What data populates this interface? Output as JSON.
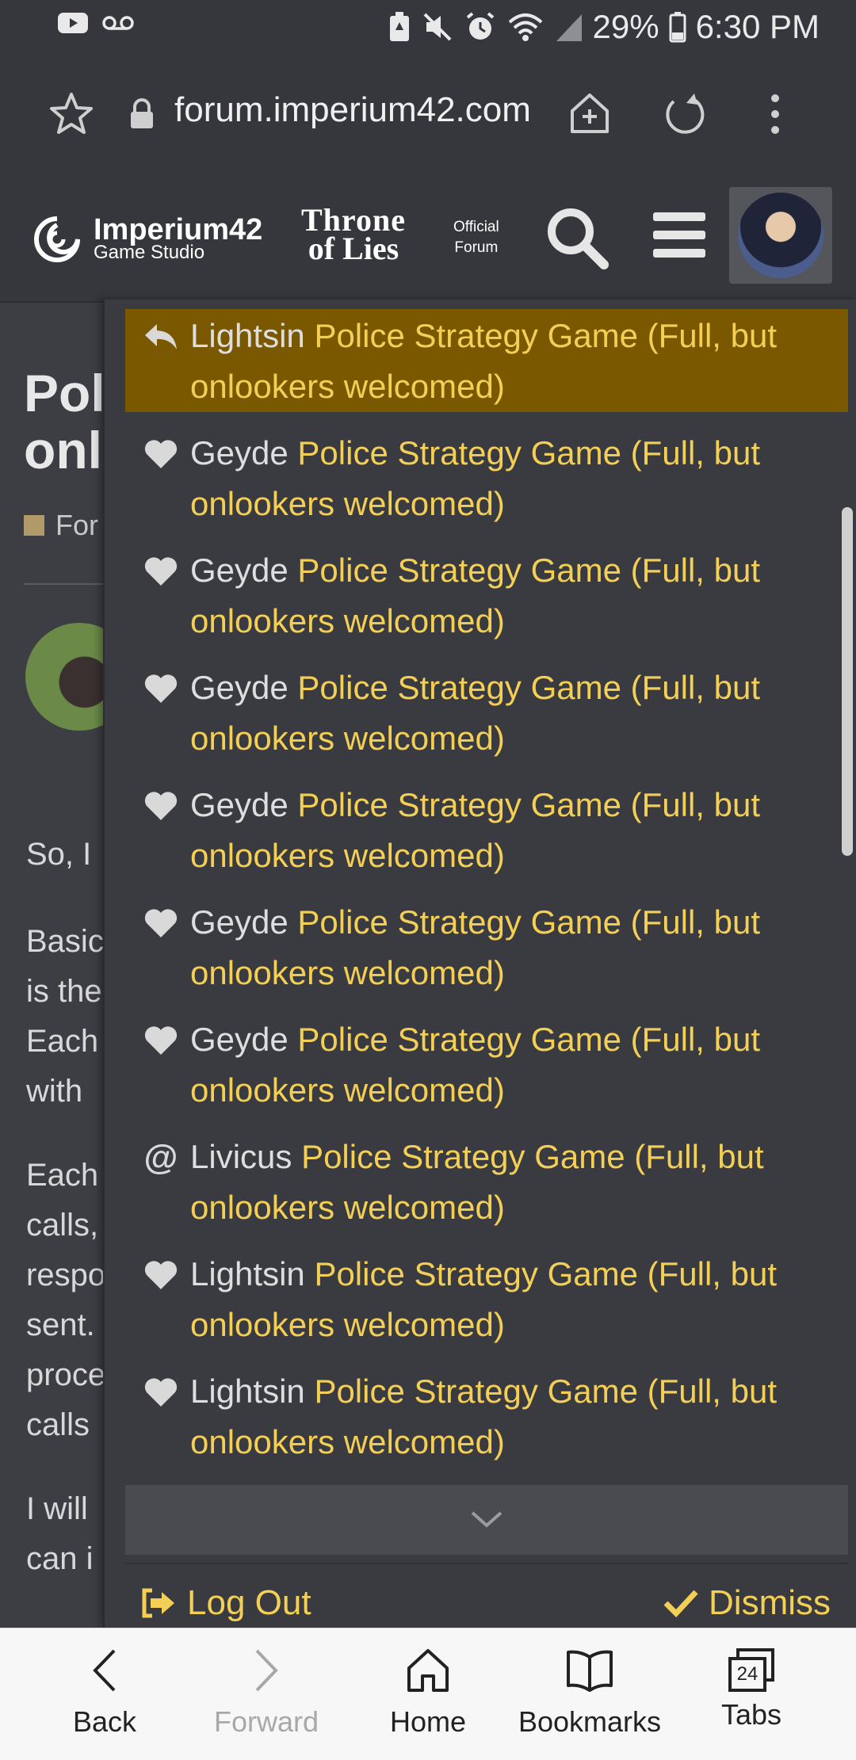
{
  "status": {
    "battery": "29%",
    "time": "6:30 PM"
  },
  "browser": {
    "url": "forum.imperium42.com"
  },
  "header": {
    "imperium_line1": "Imperium42",
    "imperium_line2": "Game Studio",
    "tol_line1": "Throne",
    "tol_line2": "of Lies",
    "official_line1": "Official",
    "official_line2": "Forum"
  },
  "background": {
    "title_line1": "Pol",
    "title_line2": "onl",
    "forum_label": "For",
    "text_lines": [
      "So, I",
      "Basic",
      "is the",
      "Each",
      "with",
      "Each",
      "calls,",
      "respo",
      "sent.",
      "proce",
      "calls",
      "I will",
      "can i"
    ]
  },
  "notifications": [
    {
      "icon": "reply-icon",
      "user": "Lightsin",
      "thread": "Police Strategy Game (Full, but onlookers welcomed)"
    },
    {
      "icon": "heart-icon",
      "user": "Geyde",
      "thread": "Police Strategy Game (Full, but onlookers welcomed)"
    },
    {
      "icon": "heart-icon",
      "user": "Geyde",
      "thread": "Police Strategy Game (Full, but onlookers welcomed)"
    },
    {
      "icon": "heart-icon",
      "user": "Geyde",
      "thread": "Police Strategy Game (Full, but onlookers welcomed)"
    },
    {
      "icon": "heart-icon",
      "user": "Geyde",
      "thread": "Police Strategy Game (Full, but onlookers welcomed)"
    },
    {
      "icon": "heart-icon",
      "user": "Geyde",
      "thread": "Police Strategy Game (Full, but onlookers welcomed)"
    },
    {
      "icon": "heart-icon",
      "user": "Geyde",
      "thread": "Police Strategy Game (Full, but onlookers welcomed)"
    },
    {
      "icon": "at-icon",
      "user": "Livicus",
      "thread": "Police Strategy Game (Full, but onlookers welcomed)"
    },
    {
      "icon": "heart-icon",
      "user": "Lightsin",
      "thread": "Police Strategy Game (Full, but onlookers welcomed)"
    },
    {
      "icon": "heart-icon",
      "user": "Lightsin",
      "thread": "Police Strategy Game (Full, but onlookers welcomed)"
    }
  ],
  "dropdown": {
    "logout_label": "Log Out",
    "dismiss_label": "Dismiss"
  },
  "bottomnav": {
    "back": "Back",
    "forward": "Forward",
    "home": "Home",
    "bookmarks": "Bookmarks",
    "tabs": "Tabs",
    "tabs_count": "24"
  },
  "colors": {
    "accent": "#f4cf56",
    "active_row": "#7a5800",
    "background": "#3d3e44"
  }
}
